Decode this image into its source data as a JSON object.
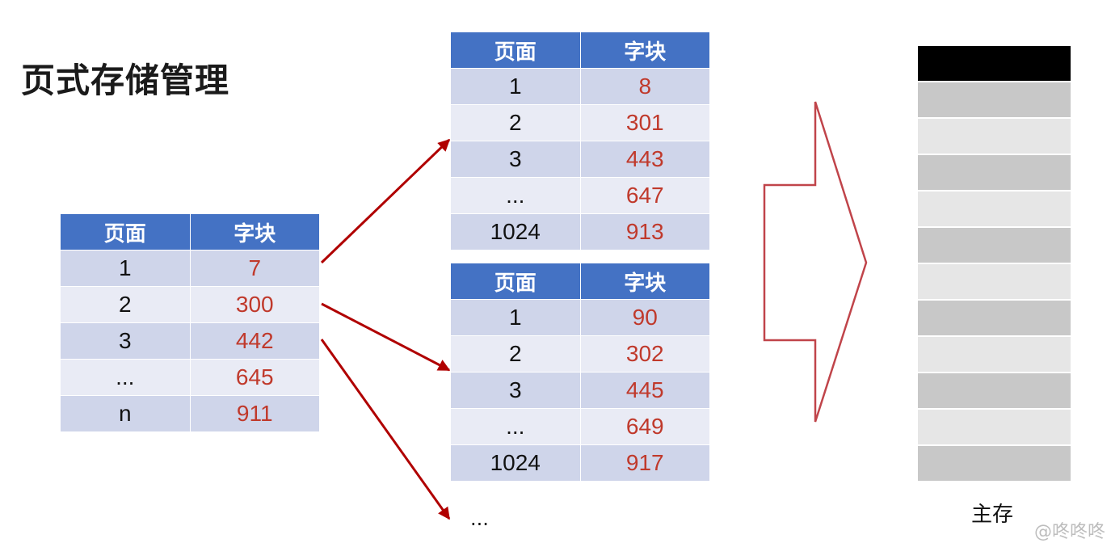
{
  "title": "页式存储管理",
  "tables": [
    {
      "headers": [
        "页面",
        "字块"
      ],
      "rows": [
        [
          "1",
          "7"
        ],
        [
          "2",
          "300"
        ],
        [
          "3",
          "442"
        ],
        [
          "...",
          "645"
        ],
        [
          "n",
          "911"
        ]
      ]
    },
    {
      "headers": [
        "页面",
        "字块"
      ],
      "rows": [
        [
          "1",
          "8"
        ],
        [
          "2",
          "301"
        ],
        [
          "3",
          "443"
        ],
        [
          "...",
          "647"
        ],
        [
          "1024",
          "913"
        ]
      ]
    },
    {
      "headers": [
        "页面",
        "字块"
      ],
      "rows": [
        [
          "1",
          "90"
        ],
        [
          "2",
          "302"
        ],
        [
          "3",
          "445"
        ],
        [
          "...",
          "649"
        ],
        [
          "1024",
          "917"
        ]
      ]
    }
  ],
  "more_label": "...",
  "memory": {
    "label": "主存",
    "cells": [
      "#000000",
      "#c8c8c8",
      "#e6e6e6",
      "#c8c8c8",
      "#e6e6e6",
      "#c8c8c8",
      "#e6e6e6",
      "#c8c8c8",
      "#e6e6e6",
      "#c8c8c8",
      "#e6e6e6",
      "#c8c8c8"
    ]
  },
  "credit": "@咚咚咚",
  "colors": {
    "header_bg": "#4472c4",
    "arrow": "#b00000",
    "big_arrow_stroke": "#c0444a",
    "value_text": "#c0392b"
  }
}
